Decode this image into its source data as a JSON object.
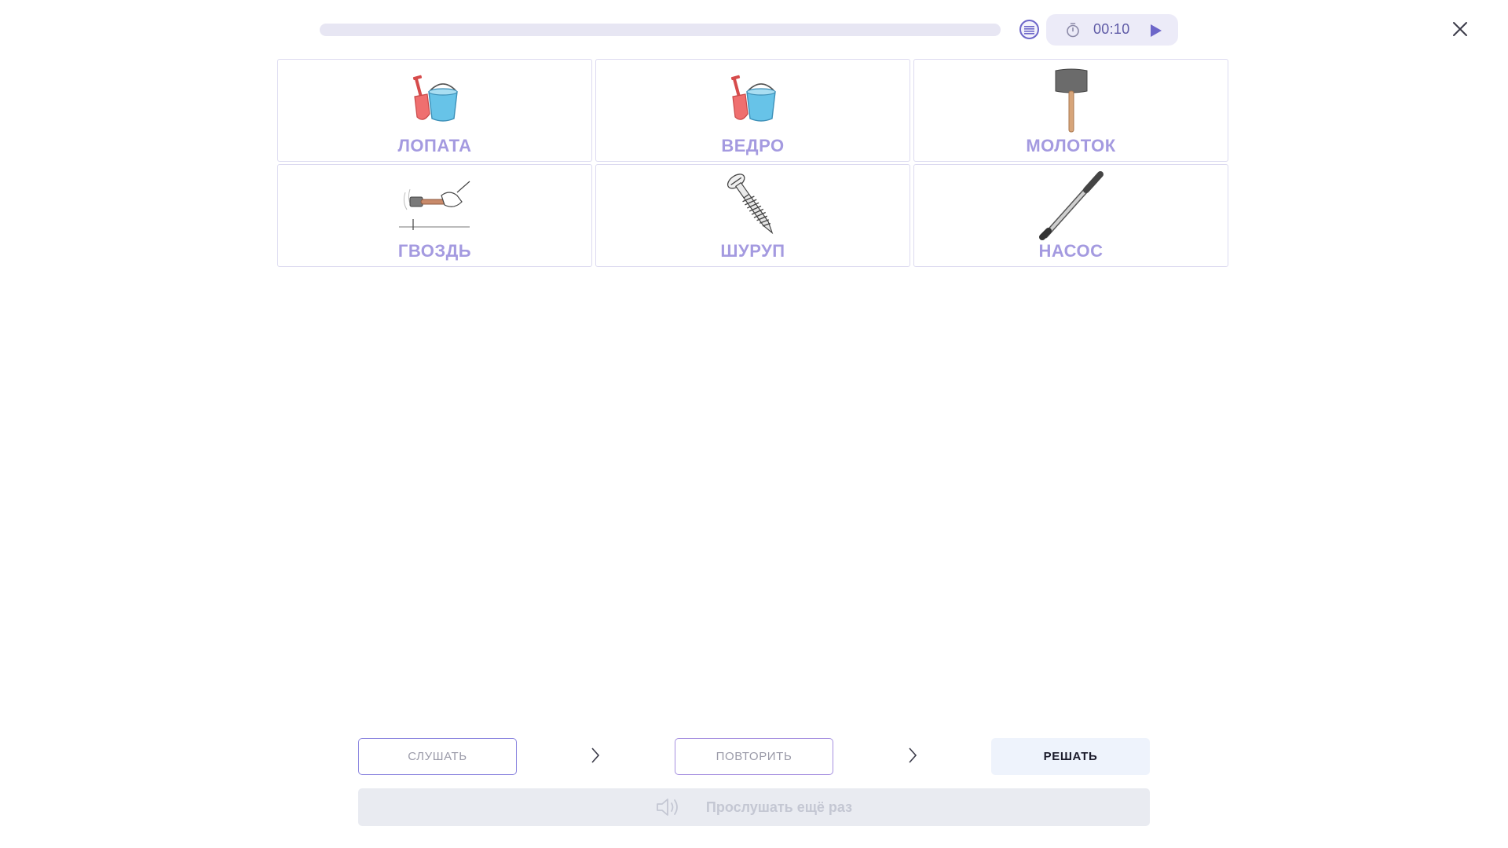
{
  "header": {
    "progress_fraction": 0.0,
    "timer": "00:10"
  },
  "cards": [
    {
      "label": "ЛОПАТА",
      "icon": "shovel-bucket-icon"
    },
    {
      "label": "ВЕДРО",
      "icon": "shovel-bucket-icon"
    },
    {
      "label": "МОЛОТОК",
      "icon": "mallet-icon"
    },
    {
      "label": "ГВОЗДЬ",
      "icon": "hammer-nail-icon"
    },
    {
      "label": "ШУРУП",
      "icon": "screw-icon"
    },
    {
      "label": "НАСОС",
      "icon": "pump-icon"
    }
  ],
  "controls": {
    "listen_label": "СЛУШАТЬ",
    "repeat_label": "ПОВТОРИТЬ",
    "solve_label": "РЕШАТЬ",
    "listen_again_label": "Прослушать ещё раз"
  },
  "colors": {
    "accent": "#6d66c9",
    "card_label": "#a49ae0",
    "card_border": "#dcdaf0",
    "disabled_bg": "#e9ebf1"
  }
}
